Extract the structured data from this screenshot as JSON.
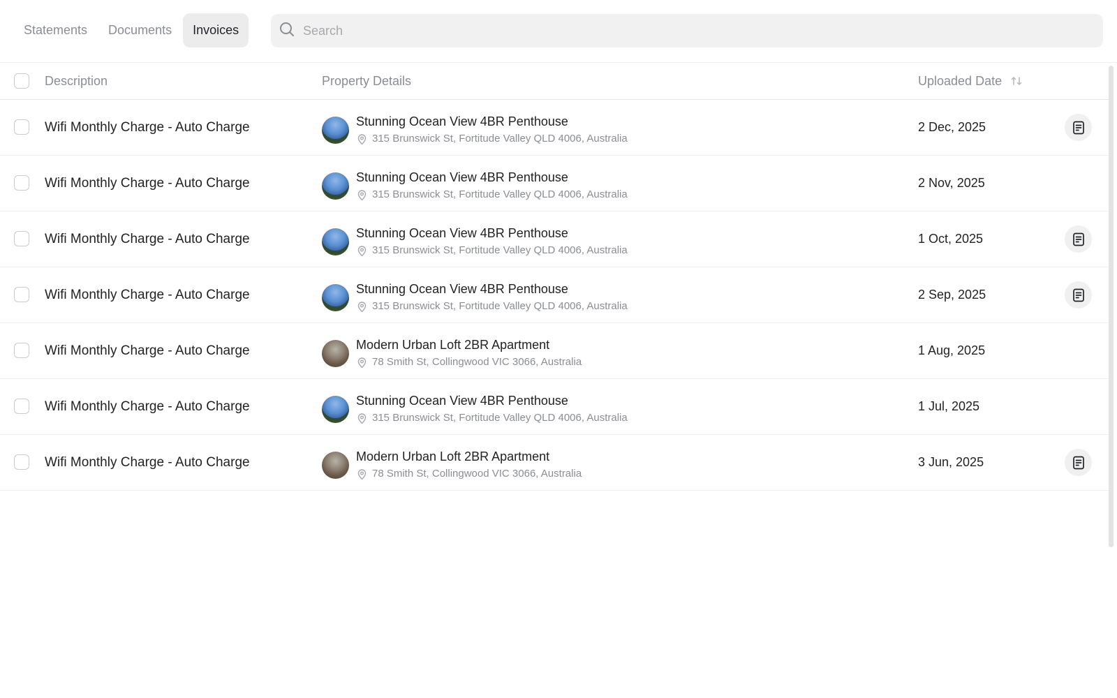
{
  "tabs": [
    {
      "label": "Statements",
      "active": false
    },
    {
      "label": "Documents",
      "active": false
    },
    {
      "label": "Invoices",
      "active": true
    }
  ],
  "search": {
    "placeholder": "Search",
    "value": ""
  },
  "table": {
    "headers": {
      "description": "Description",
      "property_details": "Property Details",
      "uploaded_date": "Uploaded Date"
    },
    "rows": [
      {
        "description": "Wifi Monthly Charge - Auto Charge",
        "property_name": "Stunning Ocean View 4BR Penthouse",
        "address": "315 Brunswick St, Fortitude Valley QLD 4006, Australia",
        "date": "2 Dec, 2025",
        "thumb": "ocean",
        "has_document": true
      },
      {
        "description": "Wifi Monthly Charge - Auto Charge",
        "property_name": "Stunning Ocean View 4BR Penthouse",
        "address": "315 Brunswick St, Fortitude Valley QLD 4006, Australia",
        "date": "2 Nov, 2025",
        "thumb": "ocean",
        "has_document": false
      },
      {
        "description": "Wifi Monthly Charge - Auto Charge",
        "property_name": "Stunning Ocean View 4BR Penthouse",
        "address": "315 Brunswick St, Fortitude Valley QLD 4006, Australia",
        "date": "1 Oct, 2025",
        "thumb": "ocean",
        "has_document": true
      },
      {
        "description": "Wifi Monthly Charge - Auto Charge",
        "property_name": "Stunning Ocean View 4BR Penthouse",
        "address": "315 Brunswick St, Fortitude Valley QLD 4006, Australia",
        "date": "2 Sep, 2025",
        "thumb": "ocean",
        "has_document": true
      },
      {
        "description": "Wifi Monthly Charge - Auto Charge",
        "property_name": "Modern Urban Loft 2BR Apartment",
        "address": "78 Smith St, Collingwood VIC 3066, Australia",
        "date": "1 Aug, 2025",
        "thumb": "loft",
        "has_document": false
      },
      {
        "description": "Wifi Monthly Charge - Auto Charge",
        "property_name": "Stunning Ocean View 4BR Penthouse",
        "address": "315 Brunswick St, Fortitude Valley QLD 4006, Australia",
        "date": "1 Jul, 2025",
        "thumb": "ocean",
        "has_document": false
      },
      {
        "description": "Wifi Monthly Charge - Auto Charge",
        "property_name": "Modern Urban Loft 2BR Apartment",
        "address": "78 Smith St, Collingwood VIC 3066, Australia",
        "date": "3 Jun, 2025",
        "thumb": "loft",
        "has_document": true
      }
    ]
  },
  "icons": {
    "search": "search-icon",
    "sort": "sort-icon",
    "location": "location-pin-icon",
    "document": "document-icon"
  }
}
